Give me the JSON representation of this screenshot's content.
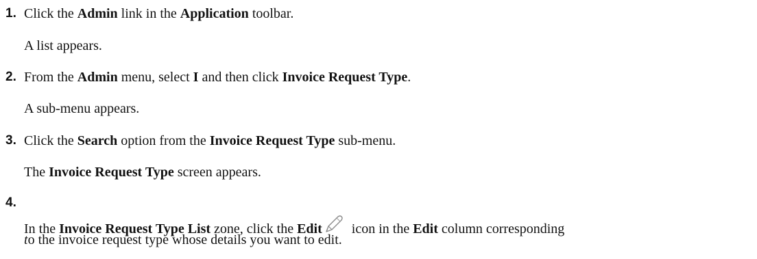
{
  "steps": [
    {
      "number": "1.",
      "instruction": {
        "t1": "Click the ",
        "b1": "Admin",
        "t2": " link in the ",
        "b2": "Application",
        "t3": " toolbar."
      },
      "result": {
        "t1": "A list appears."
      }
    },
    {
      "number": "2.",
      "instruction": {
        "t1": "From the ",
        "b1": "Admin",
        "t2": " menu, select ",
        "b2": "I",
        "t3": " and then click ",
        "b3": "Invoice Request Type",
        "t4": "."
      },
      "result": {
        "t1": "A sub-menu appears."
      }
    },
    {
      "number": "3.",
      "instruction": {
        "t1": "Click the ",
        "b1": "Search",
        "t2": " option from the ",
        "b2": "Invoice Request Type",
        "t3": " sub-menu."
      },
      "result": {
        "t1": "The ",
        "b1": "Invoice Request Type",
        "t2": " screen appears."
      }
    },
    {
      "number": "4.",
      "instruction": {
        "t1": "In the ",
        "b1": "Invoice Request Type List",
        "t2": " zone, click the ",
        "b2": "Edit",
        "icon": "pencil-edit-icon",
        "t3": " icon in the ",
        "b3": "Edit",
        "t4": " column corresponding",
        "i1": "t",
        "t5": "o the invoice request type whose details you want to edit."
      }
    }
  ]
}
